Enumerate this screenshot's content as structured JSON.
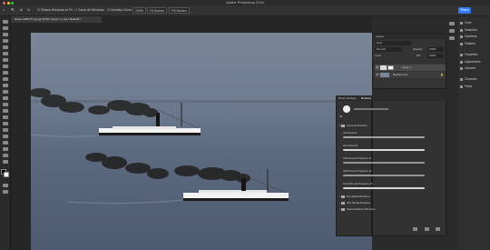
{
  "window": {
    "title": "Adobe Photoshop 2024"
  },
  "options": {
    "align_label": "Resize Windows to Fit",
    "zoom_all_label": "Zoom All Windows",
    "scrubby_label": "Scrubby Zoom",
    "zoom_value": "100%",
    "fit_label": "Fit Screen",
    "fill_label": "Fill Screen",
    "share_label": "Share"
  },
  "document_tab": {
    "label": "steam-9480747.jpg @ 66.8% (Layer 1, Layer Mask/8) *"
  },
  "layers_panel": {
    "tab": "Layers",
    "kind_label": "Kind",
    "blend_mode": "Normal",
    "opacity_label": "Opacity:",
    "opacity_value": "100%",
    "lock_label": "Lock:",
    "fill_label": "Fill:",
    "fill_value": "100%",
    "layers": [
      {
        "name": "Layer 1"
      },
      {
        "name": "Background"
      }
    ]
  },
  "brushes_panel": {
    "tabs": [
      "Brush Settings",
      "Brushes"
    ],
    "size_value": "20",
    "group_general": "General Brushes",
    "items": [
      "Soft Round",
      "Hard Round",
      "Soft Round Pressure O...",
      "Soft Round Pressure O...",
      "Hard Round Pressure O..."
    ],
    "folders": [
      "Dry Media Brushes",
      "Wet Media Brushes",
      "Special Effects Brushes"
    ]
  },
  "right_panels": {
    "items": [
      "Color",
      "Swatches",
      "Gradients",
      "Patterns",
      "Properties",
      "Adjustments",
      "Libraries",
      "Channels",
      "Paths"
    ]
  },
  "colors": {
    "accent": "#2f7cf6"
  }
}
